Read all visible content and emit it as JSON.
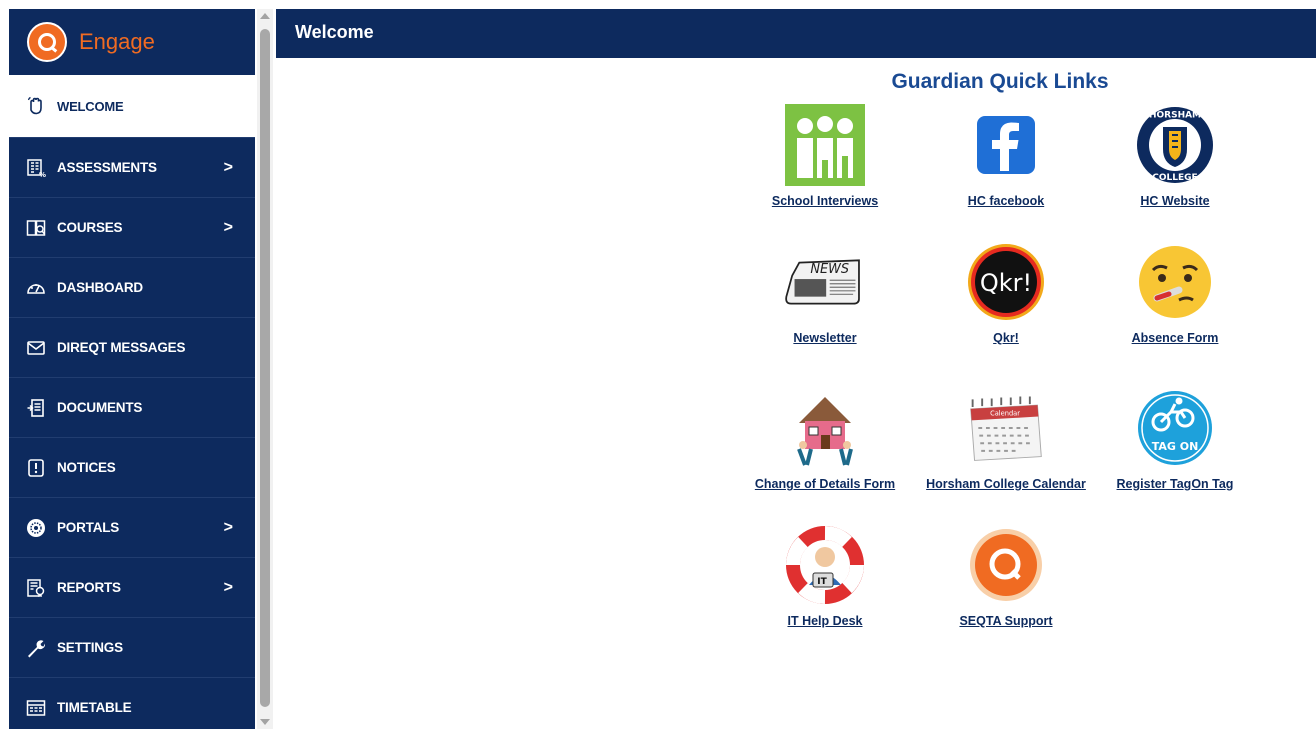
{
  "app": {
    "logo_text": "Engage",
    "accent_color": "#f06b22",
    "brand_color": "#0d2a5e"
  },
  "sidebar": {
    "items": [
      {
        "label": "WELCOME",
        "icon": "hand-wave-icon",
        "active": true
      },
      {
        "label": "ASSESSMENTS",
        "icon": "assessment-grid-icon",
        "submenu": true
      },
      {
        "label": "COURSES",
        "icon": "book-icon",
        "submenu": true
      },
      {
        "label": "DASHBOARD",
        "icon": "gauge-icon"
      },
      {
        "label": "DIREQT MESSAGES",
        "icon": "envelope-icon"
      },
      {
        "label": "DOCUMENTS",
        "icon": "document-icon"
      },
      {
        "label": "NOTICES",
        "icon": "notice-icon"
      },
      {
        "label": "PORTALS",
        "icon": "portal-burst-icon",
        "submenu": true
      },
      {
        "label": "REPORTS",
        "icon": "report-icon",
        "submenu": true
      },
      {
        "label": "SETTINGS",
        "icon": "wrench-icon"
      },
      {
        "label": "TIMETABLE",
        "icon": "timetable-icon"
      }
    ],
    "chevron": ">"
  },
  "header": {
    "title": "Welcome"
  },
  "main": {
    "quick_links_title": "Guardian Quick Links",
    "links": [
      {
        "label": "School Interviews",
        "icon": "school-interviews-icon"
      },
      {
        "label": "HC facebook",
        "icon": "facebook-icon"
      },
      {
        "label": "HC Website",
        "icon": "horsham-college-crest-icon"
      },
      {
        "label": "Newsletter",
        "icon": "newspaper-icon"
      },
      {
        "label": "Qkr!",
        "icon": "qkr-icon"
      },
      {
        "label": "Absence Form",
        "icon": "sick-face-icon"
      },
      {
        "label": "Change of Details Form",
        "icon": "moving-house-icon"
      },
      {
        "label": "Horsham College Calendar",
        "icon": "calendar-icon"
      },
      {
        "label": "Register TagOn Tag",
        "icon": "tagon-cyclist-icon"
      },
      {
        "label": "IT Help Desk",
        "icon": "lifebuoy-support-icon"
      },
      {
        "label": "SEQTA Support",
        "icon": "seqta-logo-icon"
      }
    ],
    "icon_text": {
      "newspaper": "NEWS",
      "qkr": "Qkr!",
      "crest_top": "HORSHAM",
      "crest_bottom": "COLLEGE",
      "calendar": "Calendar",
      "tagon": "TAG ON",
      "helpdesk": "IT"
    }
  }
}
